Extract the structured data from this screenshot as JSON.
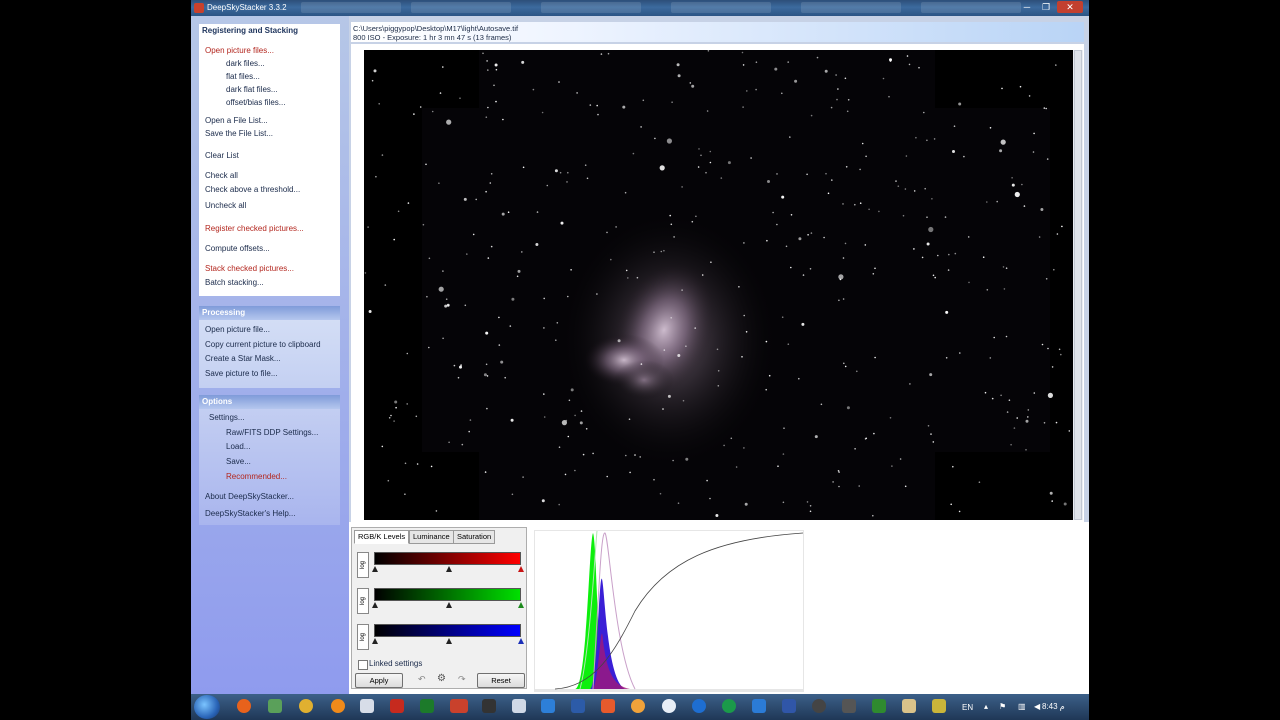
{
  "window": {
    "title": "DeepSkyStacker 3.3.2",
    "minimize": "─",
    "maximize": "❐",
    "close": "✕"
  },
  "sidebar": {
    "registering": {
      "title": "Registering and Stacking",
      "items": [
        "Open picture files...",
        "dark files...",
        "flat files...",
        "dark flat files...",
        "offset/bias files...",
        "Open a File List...",
        "Save the File List...",
        "Clear List",
        "Check all",
        "Check above a threshold...",
        "Uncheck all",
        "Register checked pictures...",
        "Compute offsets...",
        "Stack checked pictures...",
        "Batch stacking..."
      ]
    },
    "processing": {
      "title": "Processing",
      "items": [
        "Open picture file...",
        "Copy current picture to clipboard",
        "Create a Star Mask...",
        "Save picture to file..."
      ]
    },
    "options": {
      "title": "Options",
      "items": [
        "Settings...",
        "Raw/FITS DDP Settings...",
        "Load...",
        "Save...",
        "Recommended...",
        "About DeepSkyStacker...",
        "DeepSkyStacker's Help..."
      ]
    }
  },
  "image_info": {
    "path": "C:\\Users\\piggypop\\Desktop\\M17\\light\\Autosave.tif",
    "details": "800 ISO - Exposure: 1 hr 3 mn 47 s (13 frames)"
  },
  "levels": {
    "tabs": [
      "RGB/K Levels",
      "Luminance",
      "Saturation"
    ],
    "log_label": "log",
    "linked_settings": "Linked settings",
    "apply": "Apply",
    "reset": "Reset",
    "colors": {
      "red": "#ff0000",
      "green": "#00e000",
      "blue": "#0000ff"
    }
  },
  "taskbar": {
    "language": "EN",
    "clock": "8:43 م"
  }
}
